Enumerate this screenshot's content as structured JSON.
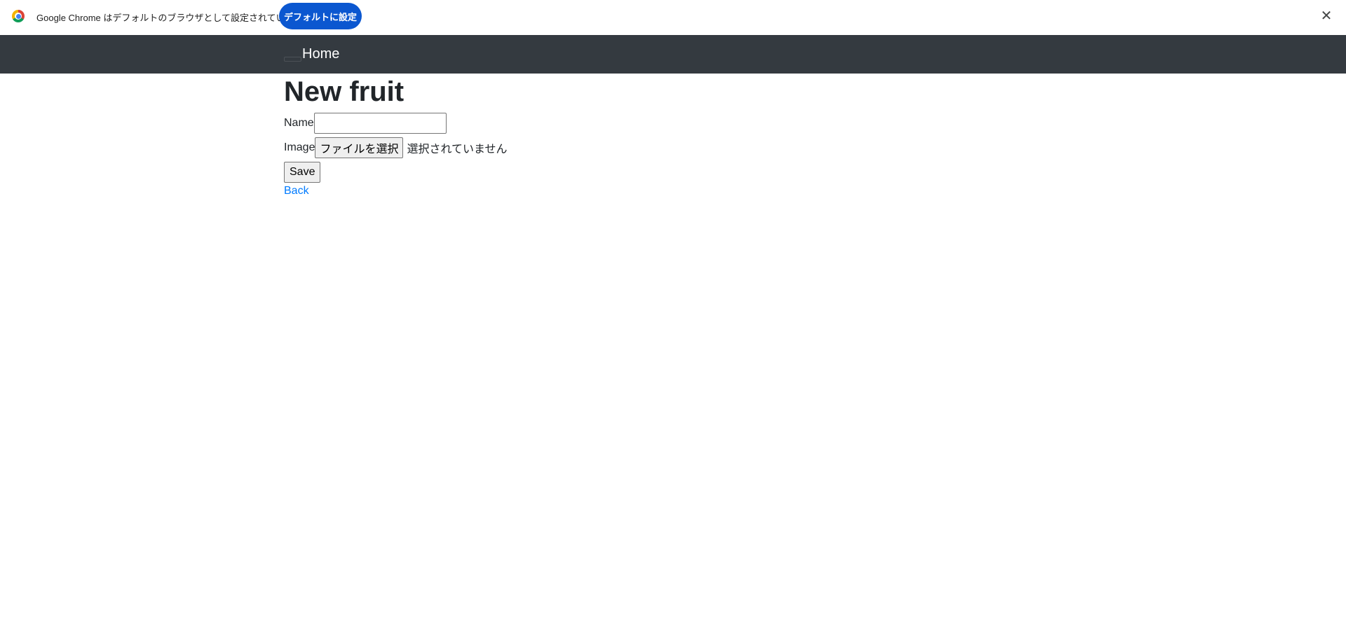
{
  "infobar": {
    "message": "Google Chrome はデフォルトのブラウザとして設定されていません",
    "button_label": "デフォルトに設定",
    "button_color": "#0b57d0",
    "close_glyph": "✕",
    "logo_icon": "chrome-logo-icon",
    "close_icon": "close-icon"
  },
  "navbar": {
    "brand": "Home",
    "background_color": "#343a40"
  },
  "page": {
    "title": "New fruit"
  },
  "form": {
    "name_label": "Name",
    "name_value": "",
    "image_label": "Image",
    "file_button_label": "ファイルを選択",
    "file_status": "選択されていません",
    "save_label": "Save"
  },
  "back_link": {
    "label": "Back",
    "color": "#007bff"
  }
}
